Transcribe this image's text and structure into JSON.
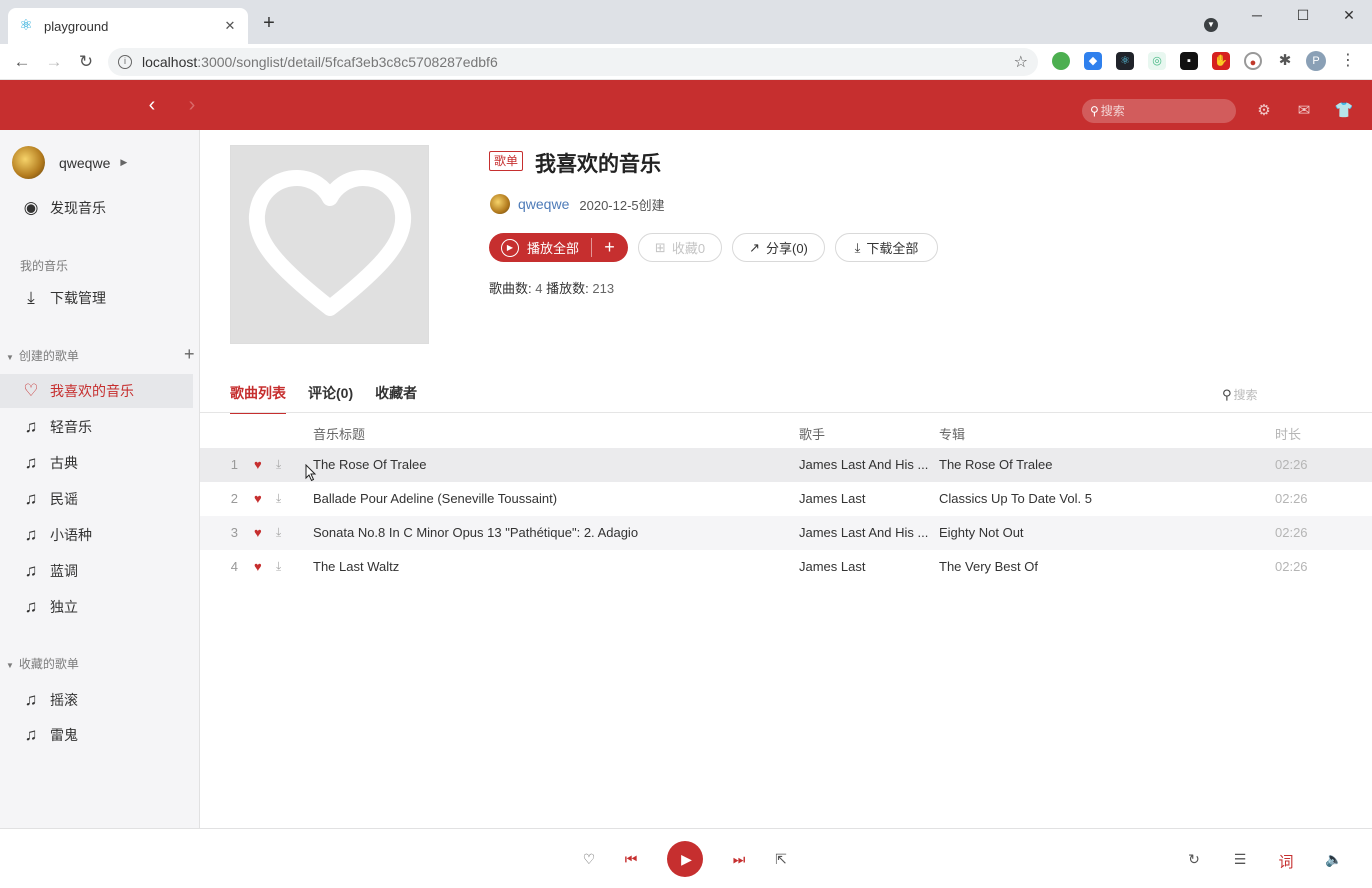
{
  "browser": {
    "tab_title": "playground",
    "url_host": "localhost",
    "url_rest": ":3000/songlist/detail/5fcaf3eb3c8c5708287edbf6",
    "profile_initial": "P"
  },
  "header": {
    "search_placeholder": "搜索"
  },
  "sidebar": {
    "username": "qweqwe",
    "discover_label": "发现音乐",
    "my_music_section": "我的音乐",
    "download_label": "下载管理",
    "created_group": "创建的歌单",
    "created_items": [
      {
        "label": "我喜欢的音乐",
        "icon": "heart-outline-icon"
      },
      {
        "label": "轻音乐",
        "icon": "music-note-icon"
      },
      {
        "label": "古典",
        "icon": "music-note-icon"
      },
      {
        "label": "民谣",
        "icon": "music-note-icon"
      },
      {
        "label": "小语种",
        "icon": "music-note-icon"
      },
      {
        "label": "蓝调",
        "icon": "music-note-icon"
      },
      {
        "label": "独立",
        "icon": "music-note-icon"
      }
    ],
    "collected_group": "收藏的歌单",
    "collected_items": [
      {
        "label": "摇滚",
        "icon": "music-note-icon"
      },
      {
        "label": "雷鬼",
        "icon": "music-note-icon"
      }
    ]
  },
  "playlist": {
    "badge": "歌单",
    "title": "我喜欢的音乐",
    "creator": "qweqwe",
    "created": "2020-12-5创建",
    "play_all": "播放全部",
    "collect": "收藏0",
    "share": "分享(0)",
    "download_all": "下载全部",
    "song_count_label": "歌曲数:",
    "song_count": "4",
    "play_count_label": "播放数:",
    "play_count": "213"
  },
  "tabs": [
    {
      "label": "歌曲列表",
      "active": true
    },
    {
      "label": "评论(0)",
      "active": false
    },
    {
      "label": "收藏者",
      "active": false
    }
  ],
  "list_search_placeholder": "搜索",
  "columns": {
    "title": "音乐标题",
    "artist": "歌手",
    "album": "专辑",
    "duration": "时长"
  },
  "songs": [
    {
      "idx": "1",
      "title": "The Rose Of Tralee",
      "artist": "James Last And His ...",
      "album": "The Rose Of Tralee",
      "duration": "02:26"
    },
    {
      "idx": "2",
      "title": "Ballade Pour Adeline (Seneville Toussaint)",
      "artist": "James Last",
      "album": "Classics Up To Date Vol. 5",
      "duration": "02:26"
    },
    {
      "idx": "3",
      "title": "Sonata No.8 In C Minor Opus 13 \"Pathétique\": 2. Adagio",
      "artist": "James Last And His ...",
      "album": "Eighty Not Out",
      "duration": "02:26"
    },
    {
      "idx": "4",
      "title": "The Last Waltz",
      "artist": "James Last",
      "album": "The Very Best Of",
      "duration": "02:26"
    }
  ],
  "player": {
    "lyrics_label": "词"
  },
  "colors": {
    "brand": "#c62f2f",
    "sidebar_bg": "#f5f5f7"
  }
}
